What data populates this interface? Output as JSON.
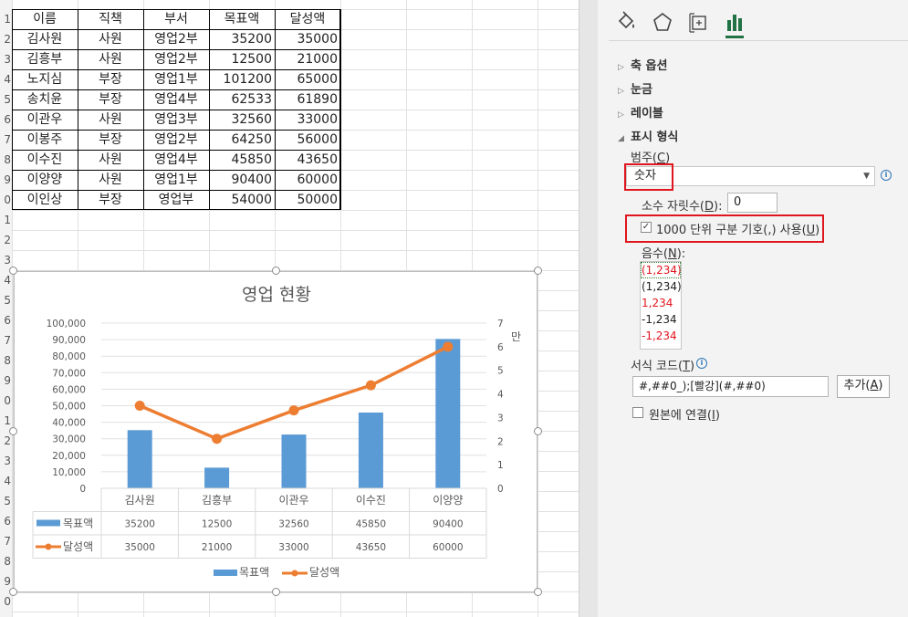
{
  "sheet": {
    "row_numbers": [
      "",
      "1",
      "2",
      "3",
      "4",
      "5",
      "6",
      "7",
      "8",
      "9",
      "0",
      "1",
      "2",
      "3",
      "4",
      "5",
      "6",
      "7",
      "8",
      "9",
      "0",
      "1",
      "2",
      "3",
      "4",
      "5",
      "6",
      "7",
      "8",
      "9",
      "0",
      "1"
    ],
    "headers": [
      "이름",
      "직책",
      "부서",
      "목표액",
      "달성액"
    ],
    "rows": [
      {
        "name": "김사원",
        "title": "사원",
        "dept": "영업2부",
        "target": "35200",
        "achieved": "35000"
      },
      {
        "name": "김흥부",
        "title": "사원",
        "dept": "영업2부",
        "target": "12500",
        "achieved": "21000"
      },
      {
        "name": "노지심",
        "title": "부장",
        "dept": "영업1부",
        "target": "101200",
        "achieved": "65000"
      },
      {
        "name": "송치윤",
        "title": "부장",
        "dept": "영업4부",
        "target": "62533",
        "achieved": "61890"
      },
      {
        "name": "이관우",
        "title": "사원",
        "dept": "영업3부",
        "target": "32560",
        "achieved": "33000"
      },
      {
        "name": "이봉주",
        "title": "부장",
        "dept": "영업2부",
        "target": "64250",
        "achieved": "56000"
      },
      {
        "name": "이수진",
        "title": "사원",
        "dept": "영업4부",
        "target": "45850",
        "achieved": "43650"
      },
      {
        "name": "이양양",
        "title": "사원",
        "dept": "영업1부",
        "target": "90400",
        "achieved": "60000"
      },
      {
        "name": "이인상",
        "title": "부장",
        "dept": "영업부",
        "target": "54000",
        "achieved": "50000"
      }
    ]
  },
  "chart_data": {
    "type": "bar",
    "title": "영업 현황",
    "categories": [
      "김사원",
      "김흥부",
      "이관우",
      "이수진",
      "이양양"
    ],
    "series": [
      {
        "name": "목표액",
        "kind": "bar",
        "axis": "primary",
        "values": [
          35200,
          12500,
          32560,
          45850,
          90400
        ],
        "color": "#5b9bd5"
      },
      {
        "name": "달성액",
        "kind": "line",
        "axis": "secondary",
        "values": [
          35000,
          21000,
          33000,
          43650,
          60000
        ],
        "color": "#ed7d31"
      }
    ],
    "primary_axis": {
      "min": 0,
      "max": 100000,
      "step": 10000,
      "tick_labels": [
        "0",
        "10,000",
        "20,000",
        "30,000",
        "40,000",
        "50,000",
        "60,000",
        "70,000",
        "80,000",
        "90,000",
        "100,000"
      ]
    },
    "secondary_axis": {
      "min": 0,
      "max": 70000,
      "tick_labels": [
        "0",
        "1",
        "2",
        "3",
        "4",
        "5",
        "6",
        "7"
      ],
      "unit_label": "만"
    },
    "data_table": {
      "rows": [
        {
          "name": "목표액",
          "values": [
            "35200",
            "12500",
            "32560",
            "45850",
            "90400"
          ]
        },
        {
          "name": "달성액",
          "values": [
            "35000",
            "21000",
            "33000",
            "43650",
            "60000"
          ]
        }
      ]
    },
    "legend": {
      "position": "bottom",
      "items": [
        "목표액",
        "달성액"
      ]
    },
    "grid": true
  },
  "panel": {
    "tab_icons": [
      "fill-bucket-icon",
      "pentagon-icon",
      "size-properties-icon",
      "bar-chart-icon"
    ],
    "sections": {
      "axis_options": "축 옵션",
      "ticks": "눈금",
      "labels": "레이블",
      "number_format": "표시 형식"
    },
    "category_label": "범주(C)",
    "category_value": "숫자",
    "decimal_places_label": "소수 자릿수(D):",
    "decimal_places_value": "0",
    "thousand_separator_label": "1000 단위 구분 기호(,) 사용(U)",
    "thousand_separator_checked": true,
    "negative_label": "음수(N):",
    "negative_options": [
      {
        "text": "(1,234)",
        "color": "#e0161e",
        "selected": true
      },
      {
        "text": "(1,234)",
        "color": "#222222",
        "selected": false
      },
      {
        "text": "1,234",
        "color": "#e0161e",
        "selected": false
      },
      {
        "text": "-1,234",
        "color": "#222222",
        "selected": false
      },
      {
        "text": "-1,234",
        "color": "#e0161e",
        "selected": false
      }
    ],
    "format_code_label": "서식 코드(T)",
    "format_code_value": "#,##0_);[빨강](#,##0)",
    "add_button": "추가(A)",
    "link_to_source_label": "원본에 연결(I)",
    "link_to_source_checked": false,
    "accent_color": "#217346"
  }
}
